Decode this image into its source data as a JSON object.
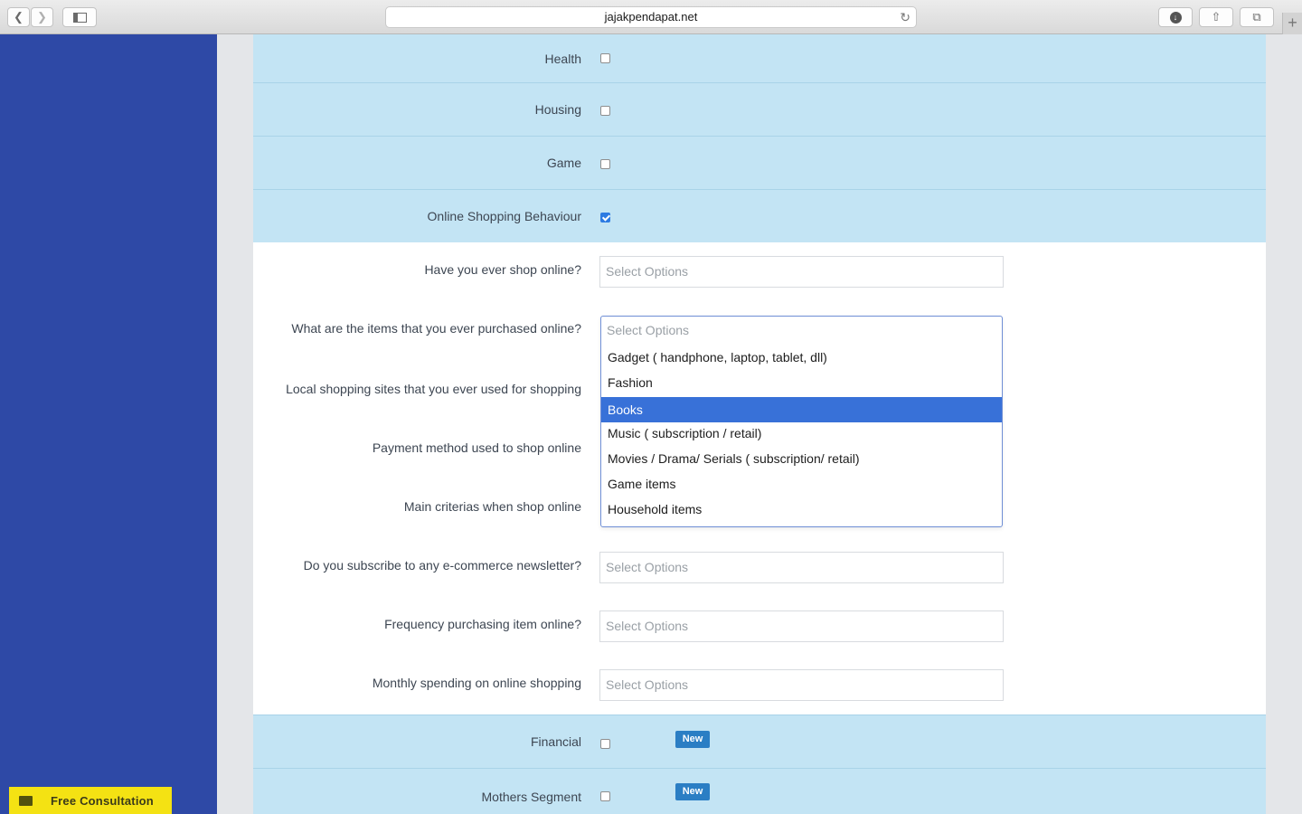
{
  "browser": {
    "url": "jajakpendapat.net"
  },
  "sidebar": {
    "consult_label": "Free Consultation"
  },
  "categories": [
    {
      "label": "Health",
      "checked": false
    },
    {
      "label": "Housing",
      "checked": false
    },
    {
      "label": "Game",
      "checked": false
    },
    {
      "label": "Online Shopping Behaviour",
      "checked": true
    }
  ],
  "questions": [
    {
      "label": "Have you ever shop online?",
      "placeholder": "Select Options"
    },
    {
      "label": "What are the items that you ever purchased online?",
      "placeholder": "Select Options"
    },
    {
      "label": "Local shopping sites that you ever used for shopping"
    },
    {
      "label": "Payment method used to shop online"
    },
    {
      "label": "Main criterias when shop online"
    },
    {
      "label": "Do you subscribe to any e-commerce newsletter?",
      "placeholder": "Select Options"
    },
    {
      "label": "Frequency purchasing item online?",
      "placeholder": "Select Options"
    },
    {
      "label": "Monthly spending on online shopping",
      "placeholder": "Select Options"
    }
  ],
  "dropdown": {
    "placeholder": "Select Options",
    "options": [
      "Gadget ( handphone, laptop, tablet, dll)",
      "Fashion",
      "Books",
      "Music ( subscription / retail)",
      "Movies / Drama/ Serials ( subscription/ retail)",
      "Game items",
      "Household items"
    ],
    "highlighted": "Books"
  },
  "bottom_categories": [
    {
      "label": "Financial",
      "checked": false,
      "badge": "New"
    },
    {
      "label": "Mothers Segment",
      "checked": false,
      "badge": "New"
    }
  ],
  "colors": {
    "sidebar": "#2e49a6",
    "band": "#c3e4f4",
    "highlight": "#3871d8",
    "badge": "#2b7ec4",
    "consult": "#f4e213"
  },
  "icons": [
    "back-icon",
    "forward-icon",
    "sidebar-icon",
    "reload-icon",
    "download-icon",
    "share-icon",
    "tabs-icon",
    "plus-icon",
    "mail-icon"
  ]
}
